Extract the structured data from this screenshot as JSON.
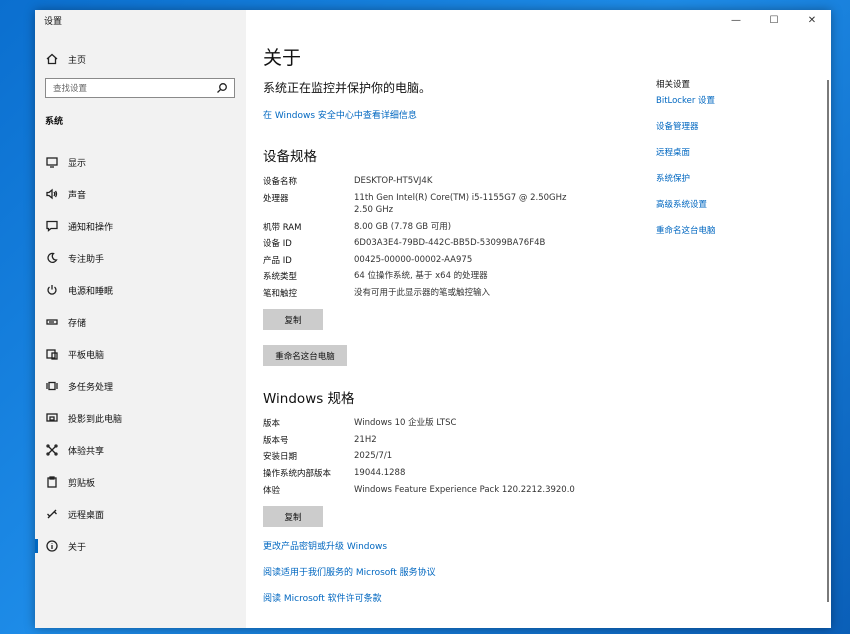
{
  "window": {
    "title": "设置",
    "controls": {
      "minimize": "—",
      "maximize": "☐",
      "close": "✕"
    }
  },
  "sidebar": {
    "home_label": "主页",
    "search_placeholder": "查找设置",
    "section": "系统",
    "items": [
      {
        "label": "显示",
        "icon": "display-icon"
      },
      {
        "label": "声音",
        "icon": "sound-icon"
      },
      {
        "label": "通知和操作",
        "icon": "notification-icon"
      },
      {
        "label": "专注助手",
        "icon": "moon-icon"
      },
      {
        "label": "电源和睡眠",
        "icon": "power-icon"
      },
      {
        "label": "存储",
        "icon": "storage-icon"
      },
      {
        "label": "平板电脑",
        "icon": "tablet-icon"
      },
      {
        "label": "多任务处理",
        "icon": "multitask-icon"
      },
      {
        "label": "投影到此电脑",
        "icon": "project-icon"
      },
      {
        "label": "体验共享",
        "icon": "share-icon"
      },
      {
        "label": "剪贴板",
        "icon": "clipboard-icon"
      },
      {
        "label": "远程桌面",
        "icon": "remote-icon"
      },
      {
        "label": "关于",
        "icon": "info-icon",
        "active": true
      }
    ]
  },
  "main": {
    "title": "关于",
    "status": "系统正在监控并保护你的电脑。",
    "security_link": "在 Windows 安全中心中查看详细信息",
    "device_specs": {
      "heading": "设备规格",
      "rows": [
        {
          "key": "设备名称",
          "value": "DESKTOP-HT5VJ4K"
        },
        {
          "key": "处理器",
          "value": "11th Gen Intel(R) Core(TM) i5-1155G7 @ 2.50GHz",
          "value2": "2.50 GHz"
        },
        {
          "key": "机带 RAM",
          "value": "8.00 GB (7.78 GB 可用)"
        },
        {
          "key": "设备 ID",
          "value": "6D03A3E4-79BD-442C-BB5D-53099BA76F4B"
        },
        {
          "key": "产品 ID",
          "value": "00425-00000-00002-AA975"
        },
        {
          "key": "系统类型",
          "value": "64 位操作系统, 基于 x64 的处理器"
        },
        {
          "key": "笔和触控",
          "value": "没有可用于此显示器的笔或触控输入"
        }
      ],
      "copy_button": "复制",
      "rename_button": "重命名这台电脑"
    },
    "windows_specs": {
      "heading": "Windows 规格",
      "rows": [
        {
          "key": "版本",
          "value": "Windows 10 企业版 LTSC"
        },
        {
          "key": "版本号",
          "value": "21H2"
        },
        {
          "key": "安装日期",
          "value": "2025/7/1"
        },
        {
          "key": "操作系统内部版本",
          "value": "19044.1288"
        },
        {
          "key": "体验",
          "value": "Windows Feature Experience Pack 120.2212.3920.0"
        }
      ],
      "copy_button": "复制"
    },
    "links": [
      "更改产品密钥或升级 Windows",
      "阅读适用于我们服务的 Microsoft 服务协议",
      "阅读 Microsoft 软件许可条款"
    ]
  },
  "related": {
    "heading": "相关设置",
    "items": [
      "BitLocker 设置",
      "设备管理器",
      "远程桌面",
      "系统保护",
      "高级系统设置",
      "重命名这台电脑"
    ]
  }
}
